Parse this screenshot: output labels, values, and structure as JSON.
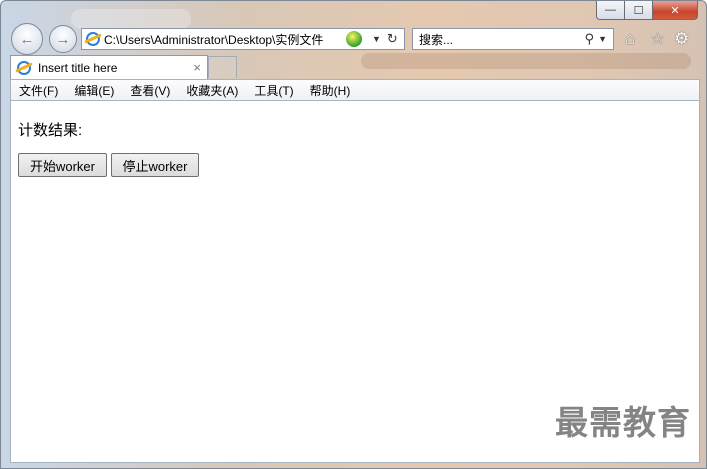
{
  "window": {
    "caption_buttons": {
      "minimize": "—",
      "maximize": "☐",
      "close": "✕"
    }
  },
  "toolbar": {
    "back_icon": "back-arrow-icon",
    "forward_icon": "forward-arrow-icon",
    "address": "C:\\Users\\Administrator\\Desktop\\实例文件",
    "search_placeholder": "搜索...",
    "icons": [
      "home-icon",
      "star-icon",
      "gear-icon"
    ]
  },
  "tab": {
    "title": "Insert title here",
    "close": "×"
  },
  "menu": {
    "items": [
      "文件(F)",
      "编辑(E)",
      "查看(V)",
      "收藏夹(A)",
      "工具(T)",
      "帮助(H)"
    ]
  },
  "page": {
    "count_label": "计数结果:",
    "start_button": "开始worker",
    "stop_button": "停止worker"
  },
  "watermark": "最需教育"
}
